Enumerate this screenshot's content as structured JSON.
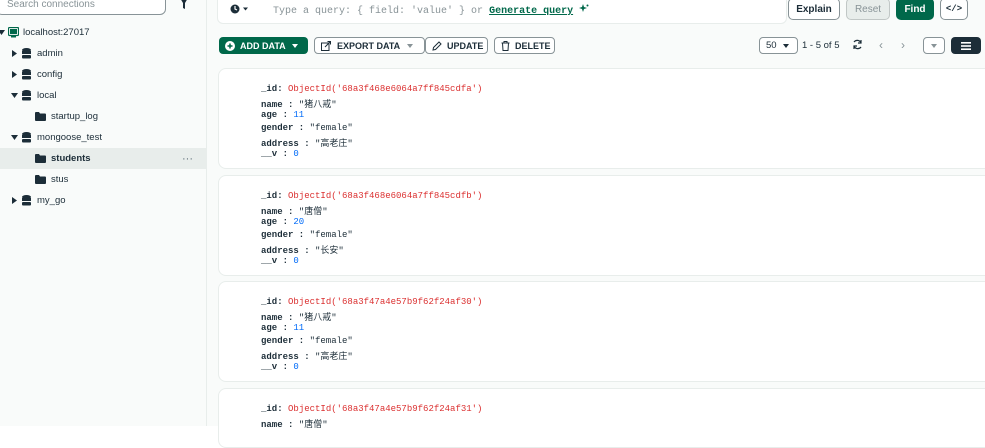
{
  "sidebar": {
    "search_placeholder": "Search connections",
    "connection": "localhost:27017",
    "databases": [
      {
        "label": "admin",
        "expanded": false
      },
      {
        "label": "config",
        "expanded": false
      },
      {
        "label": "local",
        "expanded": true
      },
      {
        "label": "mongoose_test",
        "expanded": true
      },
      {
        "label": "my_go",
        "expanded": false
      }
    ],
    "collections": {
      "local": [
        "startup_log"
      ],
      "mongoose_test": [
        "students",
        "stus"
      ]
    },
    "selected": "students",
    "more": "···"
  },
  "query": {
    "placeholder": "Type a query: { field: 'value' } or",
    "generate_link": "Generate query",
    "explain": "Explain",
    "reset": "Reset",
    "find": "Find",
    "code_toggle": "</>"
  },
  "toolbar": {
    "add_data": "ADD DATA",
    "export_data": "EXPORT DATA",
    "update": "UPDATE",
    "delete": "DELETE"
  },
  "pagination": {
    "page_size": "50",
    "range": "1 - 5 of 5"
  },
  "documents": [
    {
      "id": "ObjectId('68a3f468e6064a7ff845cdfa')",
      "name": "\"猪八戒\"",
      "age": "11",
      "gender": "\"female\"",
      "address": "\"高老庄\"",
      "v": "0"
    },
    {
      "id": "ObjectId('68a3f468e6064a7ff845cdfb')",
      "name": "\"唐僧\"",
      "age": "20",
      "gender": "\"female\"",
      "address": "\"长安\"",
      "v": "0"
    },
    {
      "id": "ObjectId('68a3f47a4e57b9f62f24af30')",
      "name": "\"猪八戒\"",
      "age": "11",
      "gender": "\"female\"",
      "address": "\"高老庄\"",
      "v": "0"
    },
    {
      "id": "ObjectId('68a3f47a4e57b9f62f24af31')",
      "name": "\"唐僧\""
    }
  ],
  "field_labels": {
    "id": "_id",
    "name": "name",
    "age": "age",
    "gender": "gender",
    "address": "address",
    "v": "__v"
  },
  "colors": {
    "brand_green": "#00684a",
    "objectid_red": "#db3030",
    "number_blue": "#016bf8"
  }
}
